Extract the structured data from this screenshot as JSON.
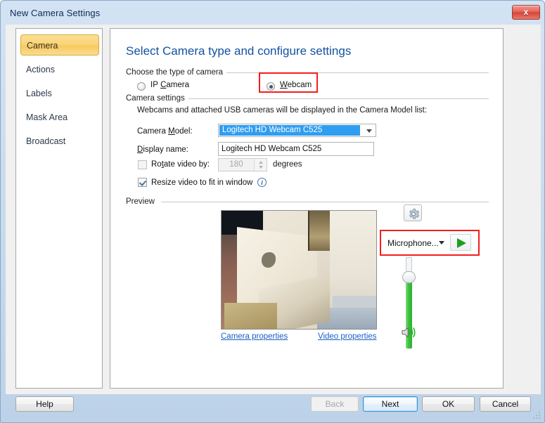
{
  "window": {
    "title": "New Camera Settings",
    "close_label": "x"
  },
  "sidebar": {
    "items": [
      {
        "label": "Camera",
        "selected": true
      },
      {
        "label": "Actions",
        "selected": false
      },
      {
        "label": "Labels",
        "selected": false
      },
      {
        "label": "Mask Area",
        "selected": false
      },
      {
        "label": "Broadcast",
        "selected": false
      }
    ]
  },
  "main": {
    "heading": "Select Camera type and configure settings",
    "camera_type_group": {
      "label": "Choose the type of camera",
      "options": [
        {
          "label": "IP Camera",
          "accel": "C",
          "selected": false
        },
        {
          "label": "Webcam",
          "accel": "W",
          "selected": true
        }
      ],
      "highlighted_option": "Webcam"
    },
    "camera_settings_group": {
      "label": "Camera settings",
      "hint": "Webcams and attached USB cameras will be displayed in the Camera Model list:",
      "camera_model_label": "Camera Model:",
      "camera_model_accel": "M",
      "camera_model_value": "Logitech HD Webcam C525",
      "display_name_label": "Display name:",
      "display_name_accel": "D",
      "display_name_value": "Logitech HD Webcam C525",
      "rotate_label": "Rotate video by:",
      "rotate_accel": "t",
      "rotate_checked": false,
      "rotate_value": "180",
      "rotate_units": "degrees",
      "resize_label": "Resize video to fit in window",
      "resize_checked": true,
      "info_glyph": "i"
    },
    "preview_group": {
      "label": "Preview",
      "camera_properties_link": "Camera properties",
      "video_properties_link": "Video properties"
    },
    "audio": {
      "settings_icon": "gear-icon",
      "device_label": "Microphone...",
      "play_icon": "play-icon",
      "volume_icon": "speaker-icon",
      "volume_percent": 72
    }
  },
  "footer": {
    "buttons": [
      {
        "label": "Help",
        "state": "normal"
      },
      {
        "label": "Back",
        "state": "disabled"
      },
      {
        "label": "Next",
        "state": "focused"
      },
      {
        "label": "OK",
        "state": "normal"
      },
      {
        "label": "Cancel",
        "state": "normal"
      }
    ]
  },
  "colors": {
    "accent_blue": "#1352a0",
    "selection_blue": "#2f9ef0",
    "highlight_red": "#f41d1d",
    "sidebar_selected": "#fad577",
    "link_blue": "#1b5fc4",
    "volume_green": "#3ec13e"
  }
}
